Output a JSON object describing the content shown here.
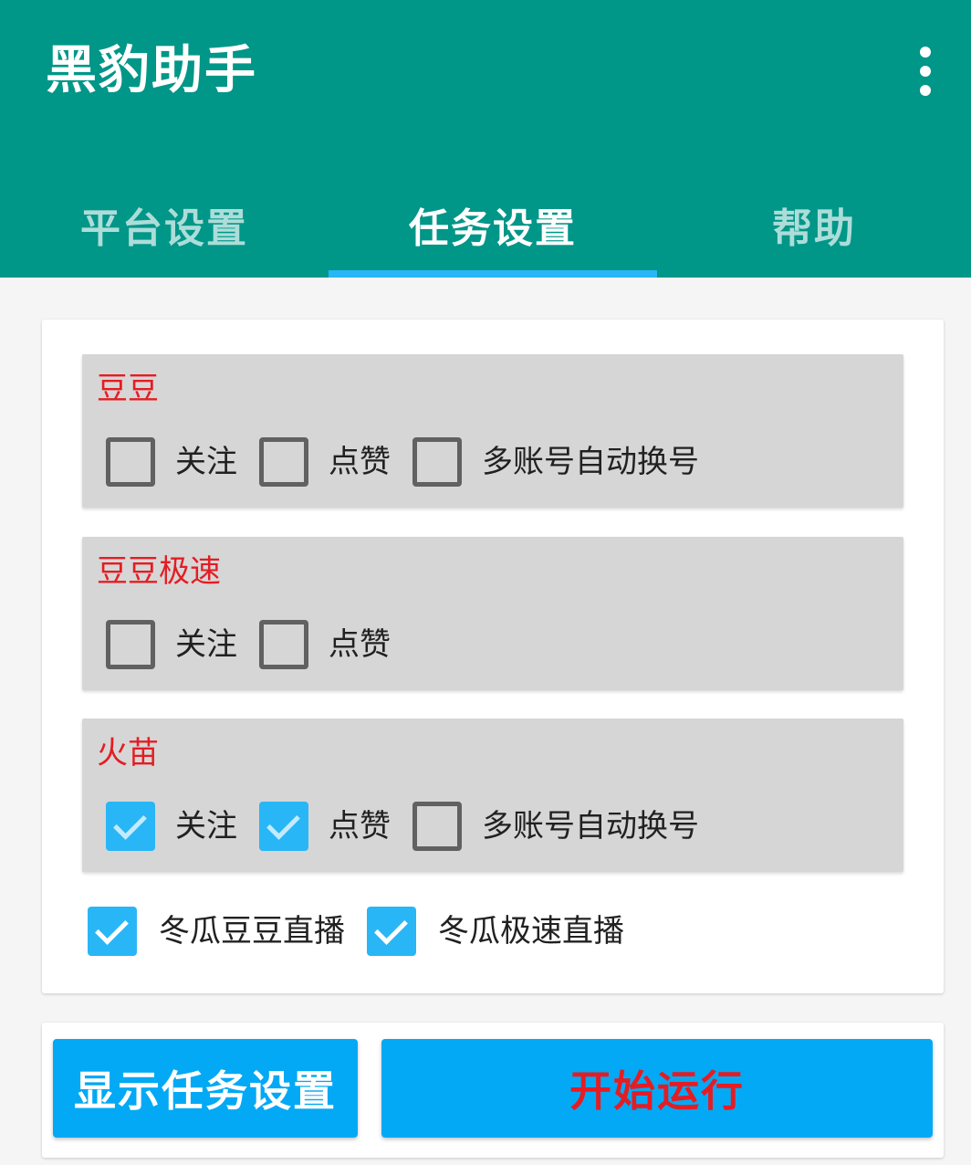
{
  "app": {
    "title": "黑豹助手",
    "menu_icon": "more-vert-icon"
  },
  "tabs": [
    {
      "label": "平台设置",
      "active": false
    },
    {
      "label": "任务设置",
      "active": true
    },
    {
      "label": "帮助",
      "active": false
    }
  ],
  "groups": [
    {
      "title": "豆豆",
      "options": [
        {
          "label": "关注",
          "checked": false
        },
        {
          "label": "点赞",
          "checked": false
        },
        {
          "label": "多账号自动换号",
          "checked": false
        }
      ]
    },
    {
      "title": "豆豆极速",
      "options": [
        {
          "label": "关注",
          "checked": false
        },
        {
          "label": "点赞",
          "checked": false
        }
      ]
    },
    {
      "title": "火苗",
      "options": [
        {
          "label": "关注",
          "checked": true
        },
        {
          "label": "点赞",
          "checked": true
        },
        {
          "label": "多账号自动换号",
          "checked": false
        }
      ]
    }
  ],
  "extra_options": [
    {
      "label": "冬瓜豆豆直播",
      "checked": true
    },
    {
      "label": "冬瓜极速直播",
      "checked": true
    }
  ],
  "buttons": {
    "show_settings": "显示任务设置",
    "start": "开始运行"
  },
  "colors": {
    "app_bar": "#009688",
    "tab_indicator": "#29b6f6",
    "accent": "#03a9f4",
    "group_title": "#e51c23",
    "start_text": "#e51c23"
  }
}
